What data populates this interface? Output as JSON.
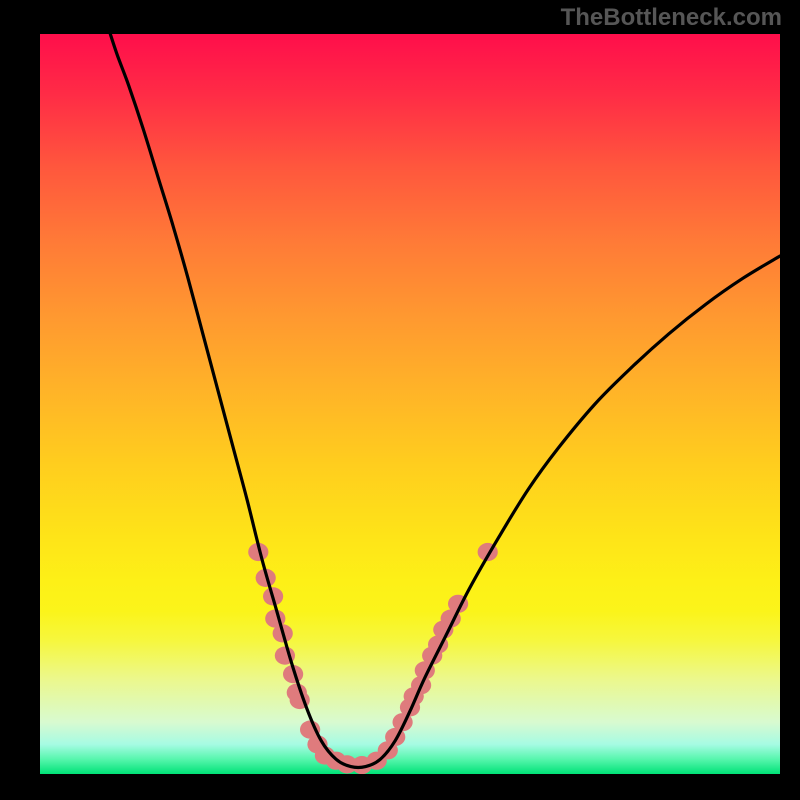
{
  "watermark": "TheBottleneck.com",
  "colors": {
    "background": "#000000",
    "gradient_top": "#ff0e4b",
    "gradient_mid": "#ffcd1e",
    "gradient_bottom": "#00e277",
    "curve": "#000000",
    "blobs": "#df7b7d"
  },
  "chart_data": {
    "type": "line",
    "title": "",
    "xlabel": "",
    "ylabel": "",
    "xlim": [
      0,
      100
    ],
    "ylim": [
      0,
      100
    ],
    "curve_points_pct": [
      [
        9.5,
        100
      ],
      [
        10.5,
        97
      ],
      [
        12,
        93
      ],
      [
        14,
        87
      ],
      [
        16,
        80.5
      ],
      [
        18,
        74
      ],
      [
        20,
        67
      ],
      [
        22,
        59.5
      ],
      [
        24,
        52
      ],
      [
        26,
        44.5
      ],
      [
        28,
        37
      ],
      [
        30,
        29
      ],
      [
        32,
        22
      ],
      [
        34,
        15
      ],
      [
        36,
        9
      ],
      [
        38,
        4.5
      ],
      [
        40,
        2
      ],
      [
        42,
        1
      ],
      [
        44,
        1
      ],
      [
        46,
        2
      ],
      [
        48,
        4.5
      ],
      [
        50,
        8.5
      ],
      [
        52,
        13
      ],
      [
        55,
        19
      ],
      [
        58,
        25
      ],
      [
        62,
        32
      ],
      [
        66,
        38.5
      ],
      [
        70,
        44
      ],
      [
        75,
        50
      ],
      [
        80,
        55
      ],
      [
        85,
        59.5
      ],
      [
        90,
        63.5
      ],
      [
        95,
        67
      ],
      [
        100,
        70
      ]
    ],
    "blob_positions_pct": [
      [
        29.5,
        30
      ],
      [
        30.5,
        26.5
      ],
      [
        31.5,
        24
      ],
      [
        31.8,
        21
      ],
      [
        32.8,
        19
      ],
      [
        33.1,
        16
      ],
      [
        34.2,
        13.5
      ],
      [
        34.7,
        11
      ],
      [
        35.1,
        10
      ],
      [
        36.5,
        6
      ],
      [
        37.5,
        4
      ],
      [
        38.5,
        2.5
      ],
      [
        40,
        1.8
      ],
      [
        41.5,
        1.3
      ],
      [
        43.5,
        1.2
      ],
      [
        45.5,
        1.8
      ],
      [
        47,
        3.2
      ],
      [
        48,
        5
      ],
      [
        49,
        7
      ],
      [
        50,
        9
      ],
      [
        50.5,
        10.5
      ],
      [
        51.5,
        12
      ],
      [
        52,
        14
      ],
      [
        53,
        16
      ],
      [
        53.8,
        17.5
      ],
      [
        54.5,
        19.5
      ],
      [
        55.5,
        21
      ],
      [
        56.5,
        23
      ],
      [
        60.5,
        30
      ]
    ],
    "blob_radius_pct": 1.3
  }
}
